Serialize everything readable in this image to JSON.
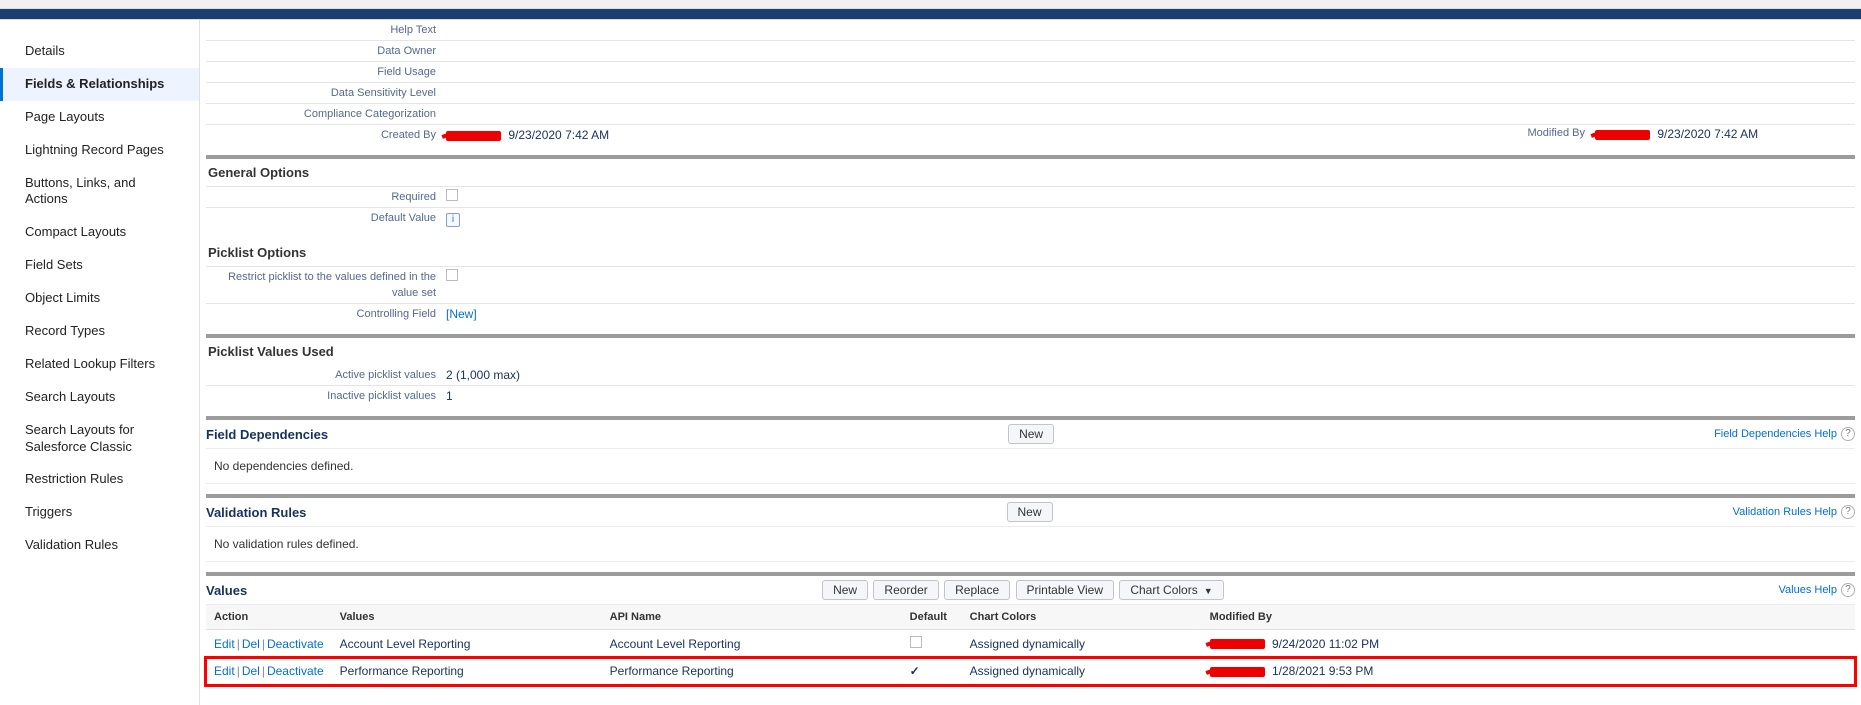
{
  "sidebar": {
    "items": [
      {
        "label": "Details"
      },
      {
        "label": "Fields & Relationships",
        "active": true
      },
      {
        "label": "Page Layouts"
      },
      {
        "label": "Lightning Record Pages"
      },
      {
        "label": "Buttons, Links, and Actions"
      },
      {
        "label": "Compact Layouts"
      },
      {
        "label": "Field Sets"
      },
      {
        "label": "Object Limits"
      },
      {
        "label": "Record Types"
      },
      {
        "label": "Related Lookup Filters"
      },
      {
        "label": "Search Layouts"
      },
      {
        "label": "Search Layouts for Salesforce Classic"
      },
      {
        "label": "Restriction Rules"
      },
      {
        "label": "Triggers"
      },
      {
        "label": "Validation Rules"
      }
    ]
  },
  "field_detail": {
    "rows": [
      {
        "label": "Help Text",
        "value": ""
      },
      {
        "label": "Data Owner",
        "value": ""
      },
      {
        "label": "Field Usage",
        "value": ""
      },
      {
        "label": "Data Sensitivity Level",
        "value": ""
      },
      {
        "label": "Compliance Categorization",
        "value": ""
      }
    ],
    "created_by_label": "Created By",
    "created_by_date": "9/23/2020 7:42 AM",
    "modified_by_label": "Modified By",
    "modified_by_date": "9/23/2020 7:42 AM"
  },
  "general_options": {
    "title": "General Options",
    "required_label": "Required",
    "default_value_label": "Default Value"
  },
  "picklist_options": {
    "title": "Picklist Options",
    "restrict_label": "Restrict picklist to the values defined in the value set",
    "controlling_label": "Controlling Field",
    "controlling_link": "[New]"
  },
  "picklist_values_used": {
    "title": "Picklist Values Used",
    "active_label": "Active picklist values",
    "active_value": "2 (1,000 max)",
    "inactive_label": "Inactive picklist values",
    "inactive_value": "1"
  },
  "field_dependencies": {
    "title": "Field Dependencies",
    "new_btn": "New",
    "help_link": "Field Dependencies Help",
    "body": "No dependencies defined."
  },
  "validation_rules": {
    "title": "Validation Rules",
    "new_btn": "New",
    "help_link": "Validation Rules Help",
    "body": "No validation rules defined."
  },
  "values_section": {
    "title": "Values",
    "buttons": {
      "new": "New",
      "reorder": "Reorder",
      "replace": "Replace",
      "printable": "Printable View",
      "chart_colors": "Chart Colors"
    },
    "help_link": "Values Help",
    "headers": {
      "action": "Action",
      "values": "Values",
      "api": "API Name",
      "default": "Default",
      "colors": "Chart Colors",
      "modified": "Modified By"
    },
    "action_links": {
      "edit": "Edit",
      "del": "Del",
      "deactivate": "Deactivate"
    },
    "rows": [
      {
        "value": "Account Level Reporting",
        "api": "Account Level Reporting",
        "default": false,
        "colors": "Assigned dynamically",
        "mod_date": "9/24/2020 11:02 PM",
        "highlight": false
      },
      {
        "value": "Performance Reporting",
        "api": "Performance Reporting",
        "default": true,
        "colors": "Assigned dynamically",
        "mod_date": "1/28/2021 9:53 PM",
        "highlight": true
      }
    ]
  }
}
